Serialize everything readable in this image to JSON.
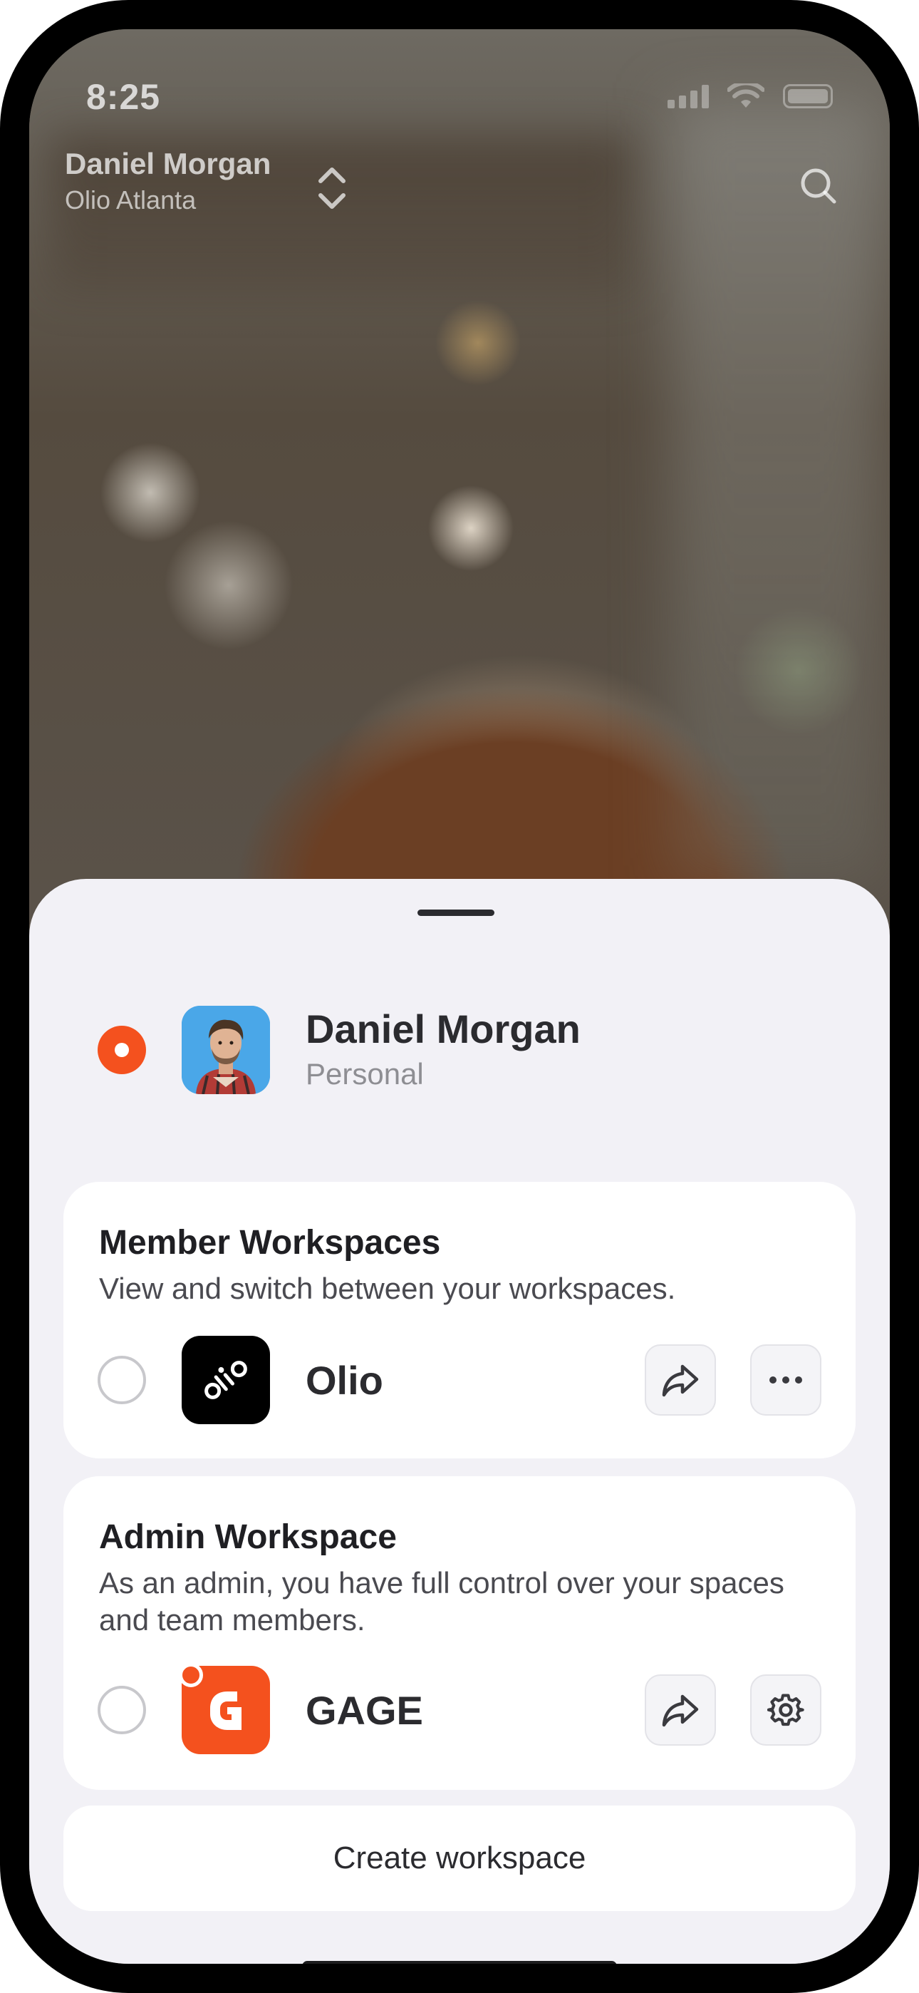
{
  "status_bar": {
    "time": "8:25"
  },
  "header": {
    "user_name": "Daniel Morgan",
    "location": "Olio Atlanta",
    "switch_icon": "chevron-up-down-icon",
    "search_icon": "search-icon"
  },
  "personal": {
    "name": "Daniel Morgan",
    "type": "Personal",
    "selected": true
  },
  "member_workspaces": {
    "title": "Member Workspaces",
    "description": "View and switch between your workspaces.",
    "items": [
      {
        "name": "Olio",
        "logo_text": "olio",
        "selected": false,
        "actions": [
          "share-icon",
          "more-icon"
        ]
      }
    ]
  },
  "admin_workspace": {
    "title": "Admin Workspace",
    "description": "As an admin, you have full control over your spaces and team members.",
    "items": [
      {
        "name": "GAGE",
        "selected": false,
        "notification_dot": true,
        "actions": [
          "share-icon",
          "gear-icon"
        ]
      }
    ]
  },
  "create_button": {
    "label": "Create workspace"
  },
  "colors": {
    "accent": "#f4511e",
    "sheet_bg": "#f2f1f6",
    "card_bg": "#ffffff",
    "olio_logo_bg": "#000000",
    "gage_logo_bg": "#f4511e",
    "avatar_bg": "#4aa7e8"
  }
}
